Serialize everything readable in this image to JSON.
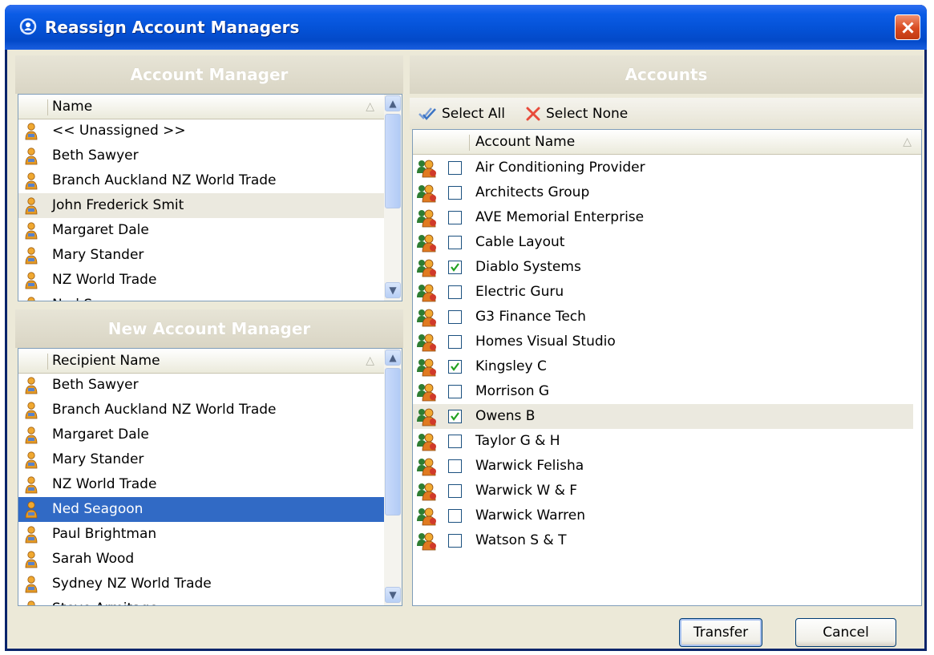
{
  "window": {
    "title": "Reassign Account Managers"
  },
  "account_manager": {
    "header": "Account Manager",
    "column": "Name",
    "rows": [
      {
        "label": "<< Unassigned >>"
      },
      {
        "label": "Beth Sawyer"
      },
      {
        "label": "Branch Auckland NZ World Trade"
      },
      {
        "label": "John Frederick Smit",
        "highlighted": true
      },
      {
        "label": "Margaret Dale"
      },
      {
        "label": "Mary Stander"
      },
      {
        "label": "NZ World Trade"
      },
      {
        "label": "Ned Seagoon"
      }
    ]
  },
  "new_account_manager": {
    "header": "New Account Manager",
    "column": "Recipient Name",
    "rows": [
      {
        "label": "Beth Sawyer"
      },
      {
        "label": "Branch Auckland NZ World Trade"
      },
      {
        "label": "Margaret Dale"
      },
      {
        "label": "Mary Stander"
      },
      {
        "label": "NZ World Trade"
      },
      {
        "label": "Ned Seagoon",
        "selected": true
      },
      {
        "label": "Paul Brightman"
      },
      {
        "label": "Sarah Wood"
      },
      {
        "label": "Sydney NZ World Trade"
      },
      {
        "label": "Steve Armitage"
      }
    ]
  },
  "accounts": {
    "header": "Accounts",
    "toolbar": {
      "select_all": "Select All",
      "select_none": "Select None"
    },
    "column": "Account Name",
    "rows": [
      {
        "label": "Air Conditioning Provider",
        "checked": false
      },
      {
        "label": "Architects Group",
        "checked": false
      },
      {
        "label": "AVE Memorial Enterprise",
        "checked": false
      },
      {
        "label": "Cable Layout",
        "checked": false
      },
      {
        "label": "Diablo Systems",
        "checked": true
      },
      {
        "label": "Electric Guru",
        "checked": false
      },
      {
        "label": "G3 Finance Tech",
        "checked": false
      },
      {
        "label": "Homes Visual Studio",
        "checked": false
      },
      {
        "label": "Kingsley C",
        "checked": true
      },
      {
        "label": "Morrison G",
        "checked": false
      },
      {
        "label": "Owens B",
        "checked": true,
        "highlighted": true
      },
      {
        "label": "Taylor G & H",
        "checked": false
      },
      {
        "label": "Warwick Felisha",
        "checked": false
      },
      {
        "label": "Warwick W & F",
        "checked": false
      },
      {
        "label": "Warwick Warren",
        "checked": false
      },
      {
        "label": "Watson S & T",
        "checked": false
      }
    ]
  },
  "buttons": {
    "transfer": "Transfer",
    "cancel": "Cancel"
  },
  "colors": {
    "title_bar": "#0553d8",
    "selection": "#316ac5",
    "dialog_bg": "#ece9d8",
    "close_button": "#d84a20"
  }
}
